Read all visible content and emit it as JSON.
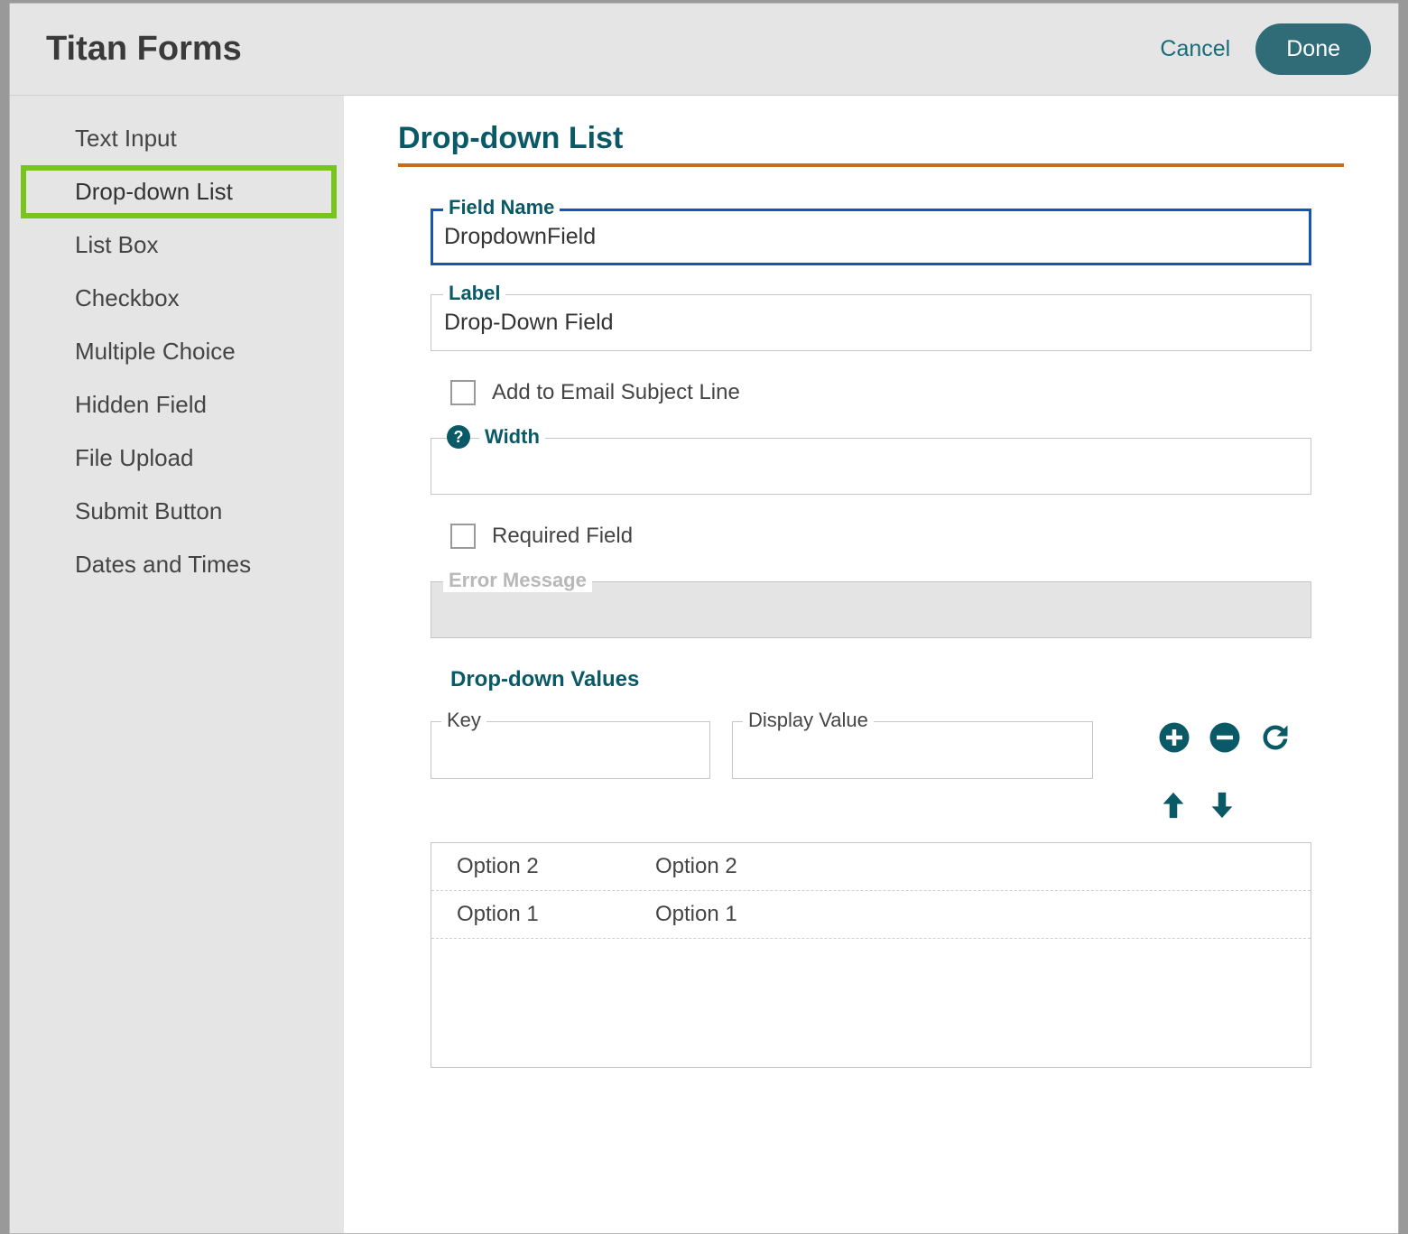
{
  "app_title": "Titan Forms",
  "header": {
    "cancel_label": "Cancel",
    "done_label": "Done"
  },
  "sidebar": {
    "items": [
      {
        "label": "Text Input"
      },
      {
        "label": "Drop-down List",
        "selected": true
      },
      {
        "label": "List Box"
      },
      {
        "label": "Checkbox"
      },
      {
        "label": "Multiple Choice"
      },
      {
        "label": "Hidden Field"
      },
      {
        "label": "File Upload"
      },
      {
        "label": "Submit Button"
      },
      {
        "label": "Dates and Times"
      }
    ]
  },
  "main": {
    "page_title": "Drop-down List",
    "field_name": {
      "legend": "Field Name",
      "value": "DropdownField"
    },
    "label": {
      "legend": "Label",
      "value": "Drop-Down Field"
    },
    "add_email_subject_label": "Add to Email Subject Line",
    "width": {
      "legend": "Width",
      "value": ""
    },
    "required_label": "Required Field",
    "error_message": {
      "legend": "Error Message",
      "value": ""
    },
    "dropdown_values_title": "Drop-down Values",
    "key_field": {
      "legend": "Key",
      "value": ""
    },
    "display_field": {
      "legend": "Display Value",
      "value": ""
    },
    "options": [
      {
        "key": "Option 2",
        "display": "Option 2"
      },
      {
        "key": "Option 1",
        "display": "Option 1"
      }
    ]
  }
}
